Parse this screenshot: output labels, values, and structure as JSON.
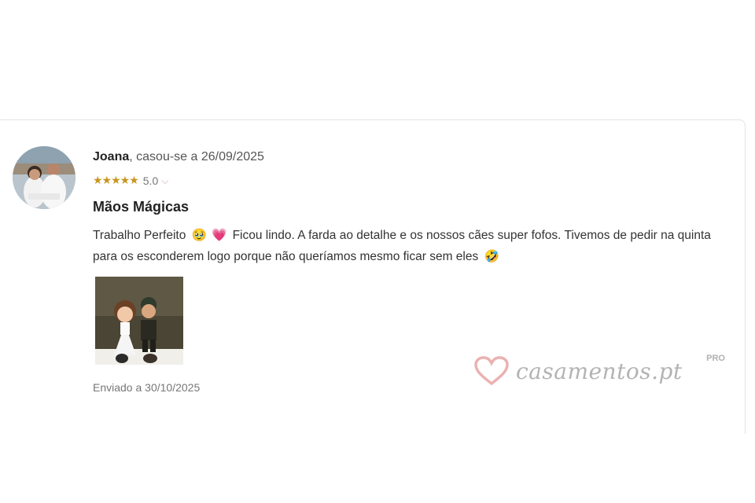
{
  "review": {
    "author_name": "Joana",
    "author_meta": ", casou-se a 26/09/2025",
    "stars": "★★★★★",
    "score": "5.0",
    "rating_value": 5,
    "title": "Mãos Mágicas",
    "text_part1": "Trabalho Perfeito",
    "emoji1": "🥹",
    "emoji2": "💗",
    "text_part2": "Ficou lindo. A farda ao detalhe e os nossos cães super fofos. Tivemos de pedir na quinta para os esconderem logo porque não queríamos mesmo ficar sem eles",
    "emoji3": "🤣",
    "sent_label": "Enviado a 30/10/2025"
  },
  "watermark": {
    "brand": "casamentos.pt",
    "badge": "PRO",
    "color": "#e8a3a3"
  },
  "icons": {
    "chevron": "chevron-down-icon",
    "heart": "heart-logo-icon"
  }
}
